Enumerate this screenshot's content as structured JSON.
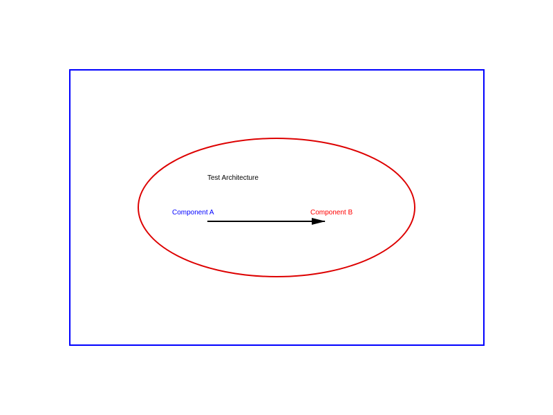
{
  "diagram": {
    "title": "Test Architecture",
    "components": [
      {
        "name": "Component A",
        "color": "#0000ff"
      },
      {
        "name": "Component B",
        "color": "#ff0000"
      }
    ],
    "frame_color": "#0000ff",
    "ellipse_color": "#dd0000",
    "arrow_color": "#000000",
    "title_color": "#000000"
  }
}
